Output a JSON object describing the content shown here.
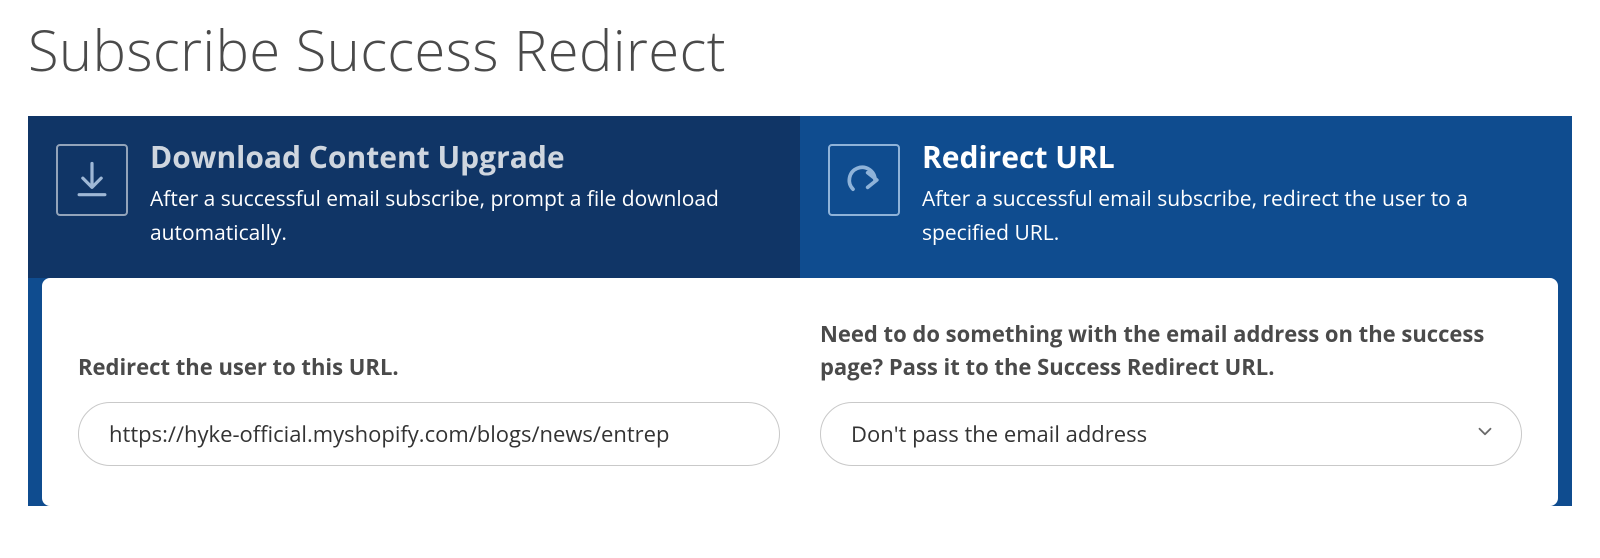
{
  "page": {
    "title": "Subscribe Success Redirect"
  },
  "tabs": {
    "download": {
      "title": "Download Content Upgrade",
      "desc": "After a successful email subscribe, prompt a file download automatically."
    },
    "redirect": {
      "title": "Redirect URL",
      "desc": "After a successful email subscribe, redirect the user to a specified URL."
    }
  },
  "form": {
    "url": {
      "label": "Redirect the user to this URL.",
      "value": "https://hyke-official.myshopify.com/blogs/news/entrep"
    },
    "email_pass": {
      "label": "Need to do something with the email address on the success page? Pass it to the Success Redirect URL.",
      "selected": "Don't pass the email address"
    }
  }
}
